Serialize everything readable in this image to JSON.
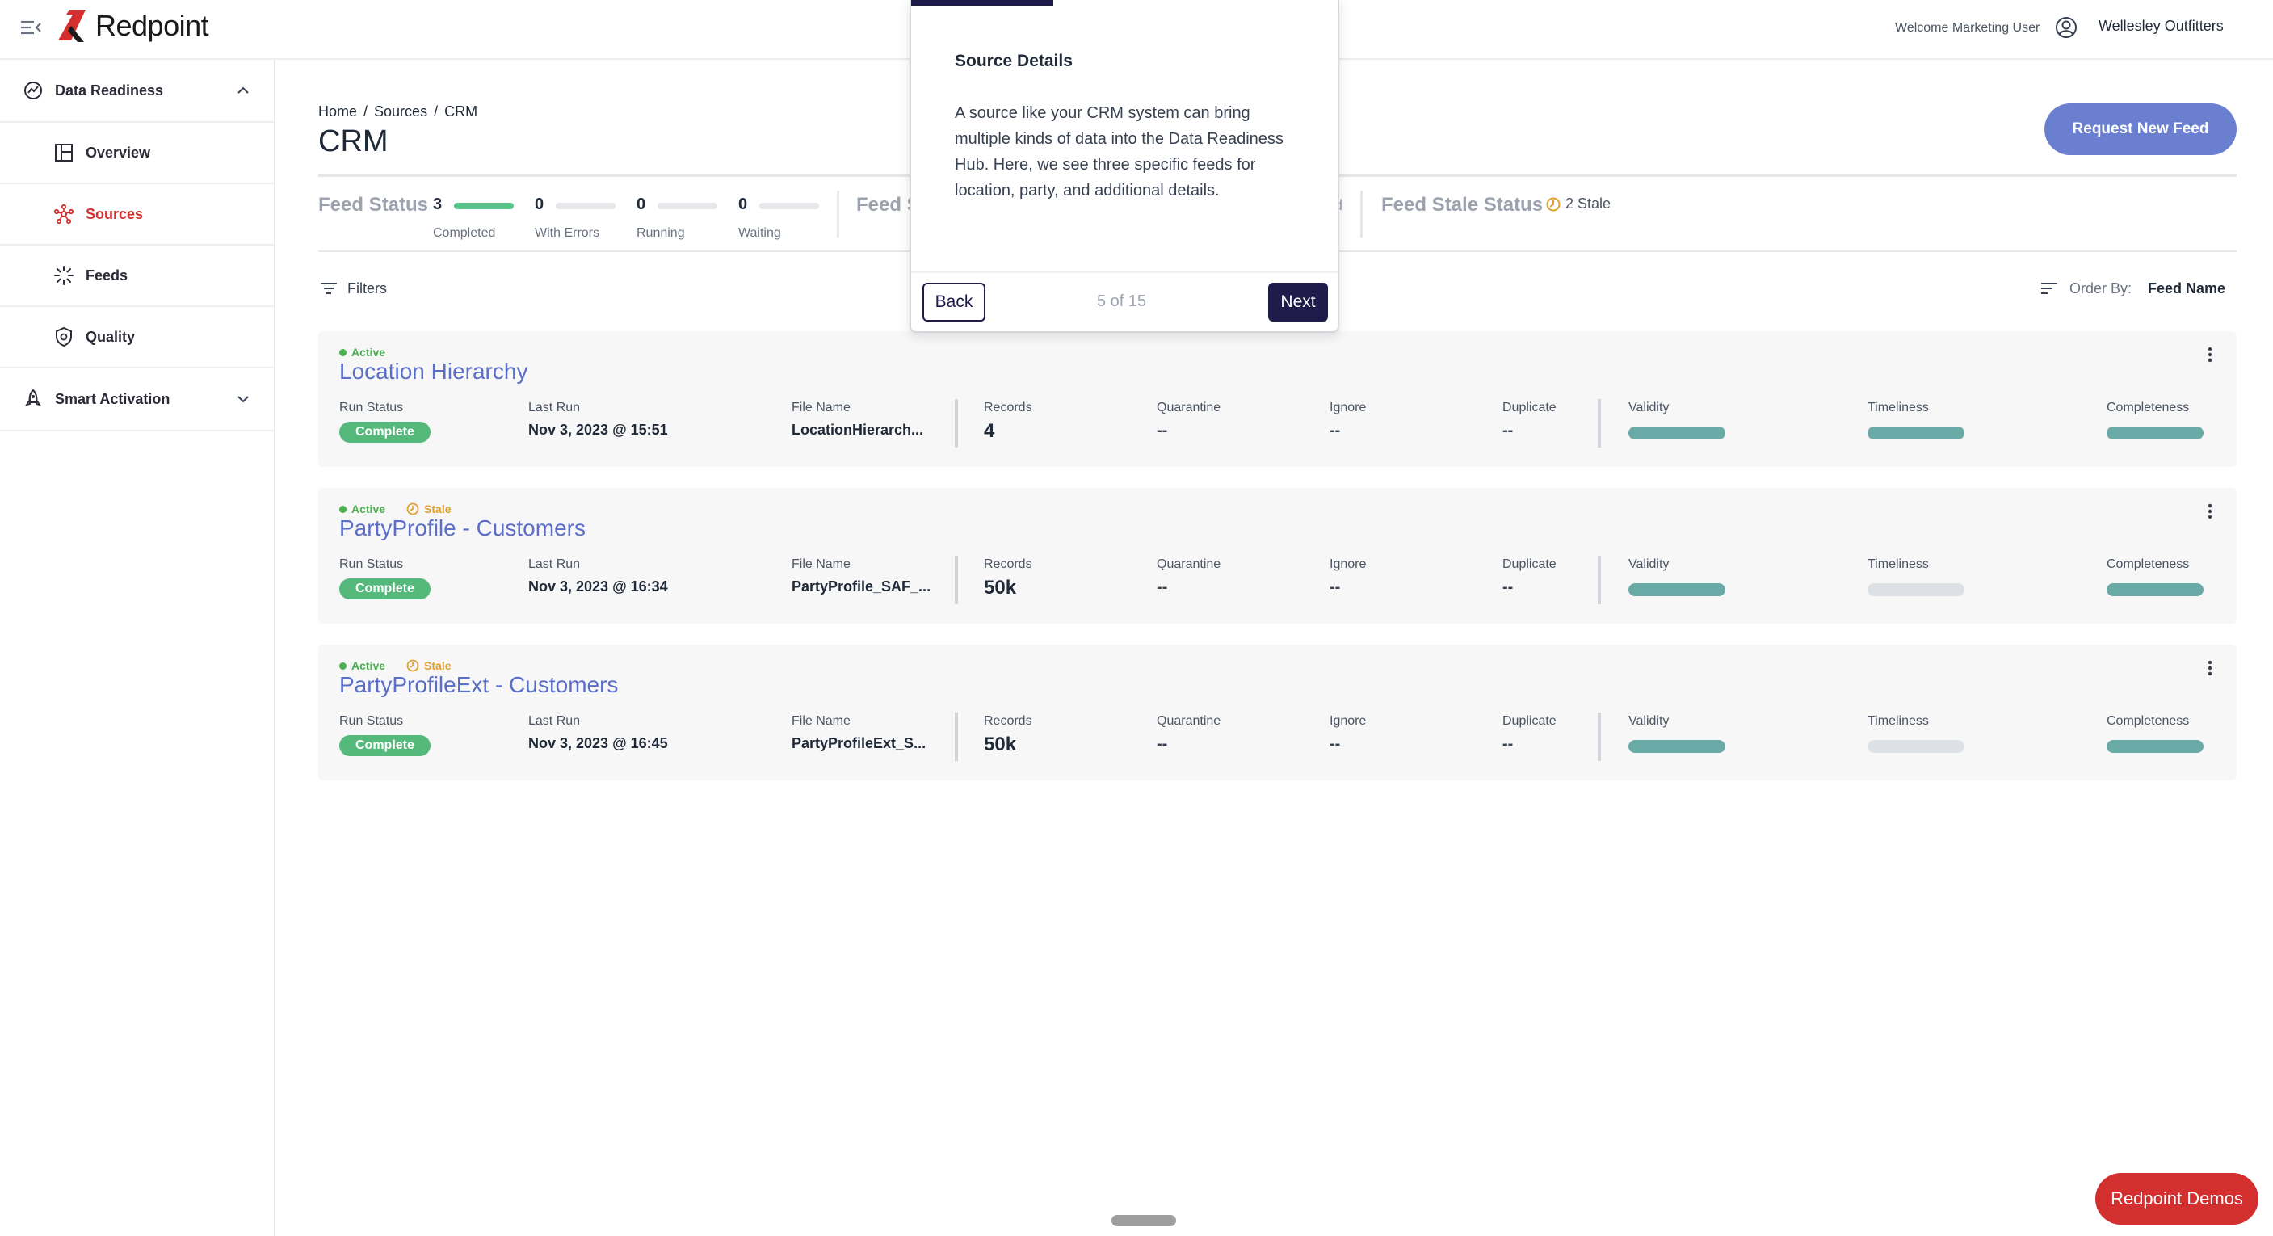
{
  "header": {
    "brand": "Redpoint",
    "welcome": "Welcome Marketing User",
    "organization": "Wellesley Outfitters",
    "brand_color": "#d32f2f"
  },
  "sidebar": {
    "groups": [
      {
        "label": "Data Readiness",
        "icon": "gauge-icon",
        "expanded": true,
        "items": [
          {
            "label": "Overview",
            "icon": "layout-icon",
            "active": false
          },
          {
            "label": "Sources",
            "icon": "network-icon",
            "active": true
          },
          {
            "label": "Feeds",
            "icon": "loader-icon",
            "active": false
          },
          {
            "label": "Quality",
            "icon": "shield-icon",
            "active": false
          }
        ]
      },
      {
        "label": "Smart Activation",
        "icon": "rocket-icon",
        "expanded": false
      }
    ]
  },
  "breadcrumb": [
    "Home",
    "Sources",
    "CRM"
  ],
  "page": {
    "title": "CRM",
    "request_button": "Request New Feed"
  },
  "feed_status": {
    "title": "Feed Status",
    "metrics": [
      {
        "value": "3",
        "label": "Completed"
      },
      {
        "value": "0",
        "label": "With Errors"
      },
      {
        "value": "0",
        "label": "Running"
      },
      {
        "value": "0",
        "label": "Waiting"
      }
    ],
    "second_title_partial": "Feed S",
    "partial_text": "d",
    "stale_title": "Feed Stale Status",
    "stale_value": "2 Stale"
  },
  "toolbar": {
    "filters_label": "Filters",
    "order_by_label": "Order By:",
    "order_by_value": "Feed Name"
  },
  "field_labels": {
    "run_status": "Run Status",
    "last_run": "Last Run",
    "file_name": "File Name",
    "records": "Records",
    "quarantine": "Quarantine",
    "ignore": "Ignore",
    "duplicate": "Duplicate",
    "validity": "Validity",
    "timeliness": "Timeliness",
    "completeness": "Completeness"
  },
  "feeds": [
    {
      "active": "Active",
      "stale": "",
      "name": "Location Hierarchy",
      "run_status": "Complete",
      "last_run": "Nov 3, 2023 @ 15:51",
      "file_name": "LocationHierarch...",
      "records": "4",
      "quarantine": "--",
      "ignore": "--",
      "duplicate": "--",
      "validity_filled": true,
      "timeliness_filled": true,
      "completeness_filled": true
    },
    {
      "active": "Active",
      "stale": "Stale",
      "name": "PartyProfile - Customers",
      "run_status": "Complete",
      "last_run": "Nov 3, 2023 @ 16:34",
      "file_name": "PartyProfile_SAF_...",
      "records": "50k",
      "quarantine": "--",
      "ignore": "--",
      "duplicate": "--",
      "validity_filled": true,
      "timeliness_filled": false,
      "completeness_filled": true
    },
    {
      "active": "Active",
      "stale": "Stale",
      "name": "PartyProfileExt - Customers",
      "run_status": "Complete",
      "last_run": "Nov 3, 2023 @ 16:45",
      "file_name": "PartyProfileExt_S...",
      "records": "50k",
      "quarantine": "--",
      "ignore": "--",
      "duplicate": "--",
      "validity_filled": true,
      "timeliness_filled": false,
      "completeness_filled": true
    }
  ],
  "tour": {
    "title": "Source Details",
    "body": "A source like your CRM system can bring multiple kinds of data into the Data Readiness Hub. Here, we see three specific feeds for location, party, and additional details.",
    "back_label": "Back",
    "counter": "5 of 15",
    "next_label": "Next",
    "progress": 0.333
  },
  "demo_button": "Redpoint Demos"
}
